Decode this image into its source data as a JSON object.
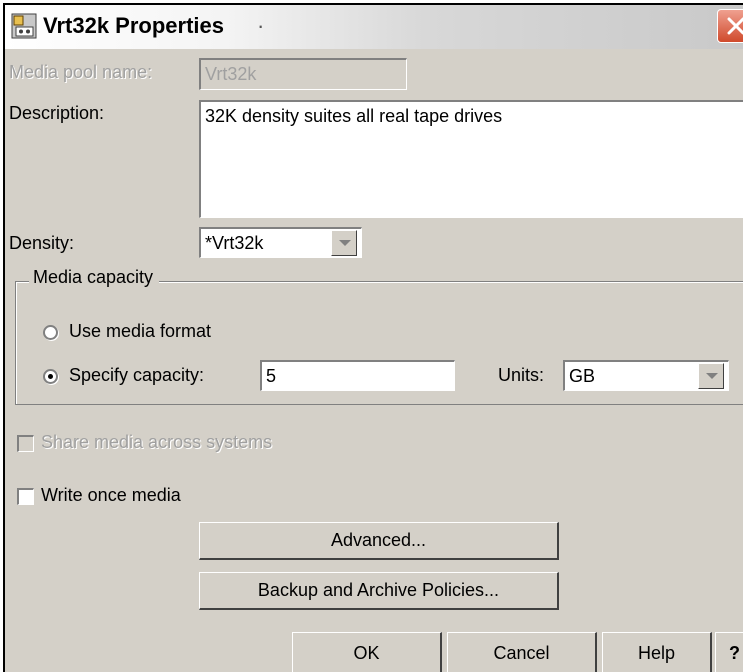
{
  "window": {
    "title": "Vrt32k Properties",
    "title_suffix": "·"
  },
  "fields": {
    "media_pool_name_label": "Media pool name:",
    "media_pool_name_value": "Vrt32k",
    "description_label": "Description:",
    "description_value": "32K density suites all real tape drives",
    "density_label": "Density:",
    "density_value": "*Vrt32k"
  },
  "media_capacity": {
    "group_label": "Media capacity",
    "use_media_format_label": "Use media format",
    "use_media_format_selected": false,
    "specify_capacity_label": "Specify capacity:",
    "specify_capacity_selected": true,
    "capacity_value": "5",
    "units_label": "Units:",
    "units_value": "GB"
  },
  "options": {
    "share_media_label": "Share media across systems",
    "share_media_checked": false,
    "share_media_enabled": false,
    "write_once_label": "Write once media",
    "write_once_checked": false
  },
  "buttons": {
    "advanced": "Advanced...",
    "backup_archive": "Backup and Archive Policies...",
    "ok": "OK",
    "cancel": "Cancel",
    "help": "Help",
    "whats_this": "?"
  },
  "colors": {
    "dialog_bg": "#d4d0c8",
    "close_button": "#d04a2c",
    "disabled_text": "#a0a0a0"
  },
  "icons": {
    "app": "tape-media-icon",
    "close": "close-icon"
  }
}
